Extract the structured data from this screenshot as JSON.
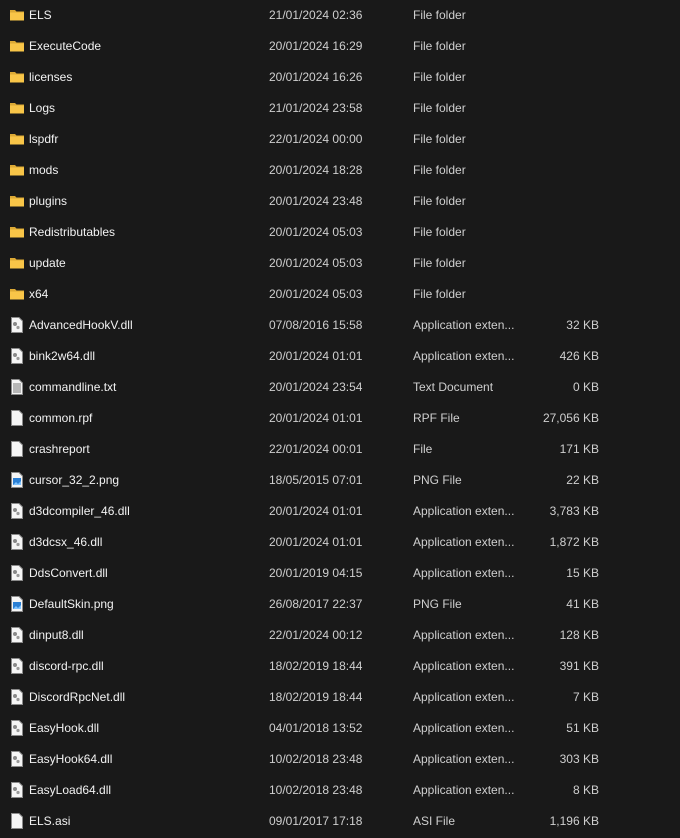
{
  "colors": {
    "background": "#191919",
    "folder": "#f8c548",
    "text": "#f2f2f2"
  },
  "files": [
    {
      "name": "ELS",
      "date": "21/01/2024 02:36",
      "type": "File folder",
      "size": "",
      "icon": "folder"
    },
    {
      "name": "ExecuteCode",
      "date": "20/01/2024 16:29",
      "type": "File folder",
      "size": "",
      "icon": "folder"
    },
    {
      "name": "licenses",
      "date": "20/01/2024 16:26",
      "type": "File folder",
      "size": "",
      "icon": "folder"
    },
    {
      "name": "Logs",
      "date": "21/01/2024 23:58",
      "type": "File folder",
      "size": "",
      "icon": "folder"
    },
    {
      "name": "lspdfr",
      "date": "22/01/2024 00:00",
      "type": "File folder",
      "size": "",
      "icon": "folder"
    },
    {
      "name": "mods",
      "date": "20/01/2024 18:28",
      "type": "File folder",
      "size": "",
      "icon": "folder"
    },
    {
      "name": "plugins",
      "date": "20/01/2024 23:48",
      "type": "File folder",
      "size": "",
      "icon": "folder"
    },
    {
      "name": "Redistributables",
      "date": "20/01/2024 05:03",
      "type": "File folder",
      "size": "",
      "icon": "folder"
    },
    {
      "name": "update",
      "date": "20/01/2024 05:03",
      "type": "File folder",
      "size": "",
      "icon": "folder"
    },
    {
      "name": "x64",
      "date": "20/01/2024 05:03",
      "type": "File folder",
      "size": "",
      "icon": "folder"
    },
    {
      "name": "AdvancedHookV.dll",
      "date": "07/08/2016 15:58",
      "type": "Application exten...",
      "size": "32 KB",
      "icon": "dll"
    },
    {
      "name": "bink2w64.dll",
      "date": "20/01/2024 01:01",
      "type": "Application exten...",
      "size": "426 KB",
      "icon": "dll"
    },
    {
      "name": "commandline.txt",
      "date": "20/01/2024 23:54",
      "type": "Text Document",
      "size": "0 KB",
      "icon": "text"
    },
    {
      "name": "common.rpf",
      "date": "20/01/2024 01:01",
      "type": "RPF File",
      "size": "27,056 KB",
      "icon": "file"
    },
    {
      "name": "crashreport",
      "date": "22/01/2024 00:01",
      "type": "File",
      "size": "171 KB",
      "icon": "file"
    },
    {
      "name": "cursor_32_2.png",
      "date": "18/05/2015 07:01",
      "type": "PNG File",
      "size": "22 KB",
      "icon": "image"
    },
    {
      "name": "d3dcompiler_46.dll",
      "date": "20/01/2024 01:01",
      "type": "Application exten...",
      "size": "3,783 KB",
      "icon": "dll"
    },
    {
      "name": "d3dcsx_46.dll",
      "date": "20/01/2024 01:01",
      "type": "Application exten...",
      "size": "1,872 KB",
      "icon": "dll"
    },
    {
      "name": "DdsConvert.dll",
      "date": "20/01/2019 04:15",
      "type": "Application exten...",
      "size": "15 KB",
      "icon": "dll"
    },
    {
      "name": "DefaultSkin.png",
      "date": "26/08/2017 22:37",
      "type": "PNG File",
      "size": "41 KB",
      "icon": "image"
    },
    {
      "name": "dinput8.dll",
      "date": "22/01/2024 00:12",
      "type": "Application exten...",
      "size": "128 KB",
      "icon": "dll"
    },
    {
      "name": "discord-rpc.dll",
      "date": "18/02/2019 18:44",
      "type": "Application exten...",
      "size": "391 KB",
      "icon": "dll"
    },
    {
      "name": "DiscordRpcNet.dll",
      "date": "18/02/2019 18:44",
      "type": "Application exten...",
      "size": "7 KB",
      "icon": "dll"
    },
    {
      "name": "EasyHook.dll",
      "date": "04/01/2018 13:52",
      "type": "Application exten...",
      "size": "51 KB",
      "icon": "dll"
    },
    {
      "name": "EasyHook64.dll",
      "date": "10/02/2018 23:48",
      "type": "Application exten...",
      "size": "303 KB",
      "icon": "dll"
    },
    {
      "name": "EasyLoad64.dll",
      "date": "10/02/2018 23:48",
      "type": "Application exten...",
      "size": "8 KB",
      "icon": "dll"
    },
    {
      "name": "ELS.asi",
      "date": "09/01/2017 17:18",
      "type": "ASI File",
      "size": "1,196 KB",
      "icon": "file"
    }
  ]
}
